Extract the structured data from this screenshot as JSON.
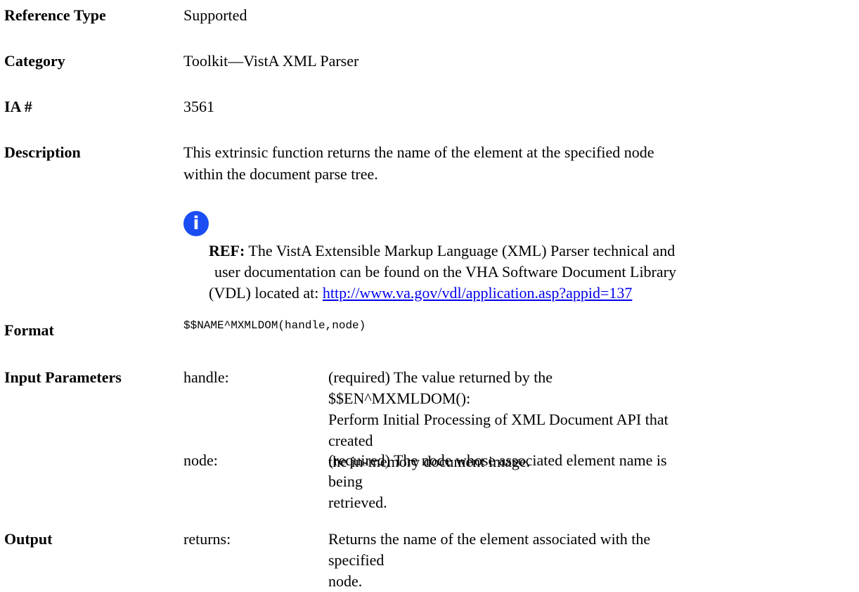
{
  "rows": {
    "reference_type": {
      "label": "Reference Type",
      "value": "Supported"
    },
    "category": {
      "label": "Category",
      "value": "Toolkit—VistA XML Parser"
    },
    "ia": {
      "label": "IA #",
      "value": "3561"
    },
    "description": {
      "label": "Description",
      "text_line1": "This extrinsic function returns the name of the element at the specified node",
      "text_line2": "within the document parse tree.",
      "note": {
        "icon": "info-icon",
        "icon_glyph": "i",
        "ref_label": "REF:",
        "ref_line1_rest": " The VistA Extensible Markup Language (XML) Parser technical and",
        "ref_line2": "user documentation can be found on the VHA Software Document Library",
        "ref_line3_prefix": "(VDL) located at: ",
        "link": "http://www.va.gov/vdl/application.asp?appid=137"
      }
    },
    "format": {
      "label": "Format",
      "value": "$$NAME^MXMLDOM(handle,node)"
    },
    "input_parameters": {
      "label": "Input Parameters",
      "params": [
        {
          "name": "handle:",
          "desc_lines": [
            "(required) The value returned by the $$EN^MXMLDOM():",
            "Perform Initial Processing of XML Document API that created",
            "the in-memory document image."
          ]
        },
        {
          "name": "node:",
          "desc_lines": [
            "(required) The node whose associated element name is being",
            "retrieved."
          ]
        }
      ]
    },
    "output": {
      "label": "Output",
      "param": {
        "name": "returns:",
        "desc_lines": [
          "Returns the name of the element associated with the specified",
          "node."
        ]
      }
    }
  },
  "colors": {
    "link": "#0000ee",
    "icon": "#1a4ef2"
  }
}
